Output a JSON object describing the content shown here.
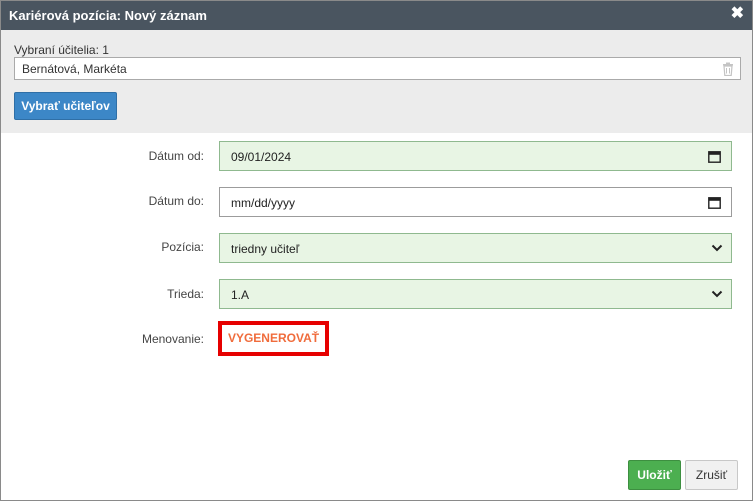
{
  "dialog": {
    "title": "Kariérová pozícia: Nový záznam",
    "close_glyph": "✖"
  },
  "teachers": {
    "selected_label": "Vybraní účitelia: 1",
    "selected_name": "Bernátová, Markéta",
    "select_button": "Vybrať učiteľov"
  },
  "form": {
    "date_from": {
      "label": "Dátum od:",
      "value": "09/01/2024"
    },
    "date_to": {
      "label": "Dátum do:",
      "value": "mm/dd/yyyy"
    },
    "position": {
      "label": "Pozícia:",
      "value": "triedny učiteľ"
    },
    "class": {
      "label": "Trieda:",
      "value": "1.A"
    },
    "appointment": {
      "label": "Menovanie:",
      "action": "VYGENEROVAŤ"
    }
  },
  "footer": {
    "save": "Uložiť",
    "cancel": "Zrušiť"
  },
  "colors": {
    "titlebar": "#4a5560",
    "valid_field": "#e8f5e4",
    "primary_button": "#3c87c7",
    "save_button": "#4caf50",
    "highlight_border": "#e60000",
    "generate_text": "#f06c3c"
  }
}
